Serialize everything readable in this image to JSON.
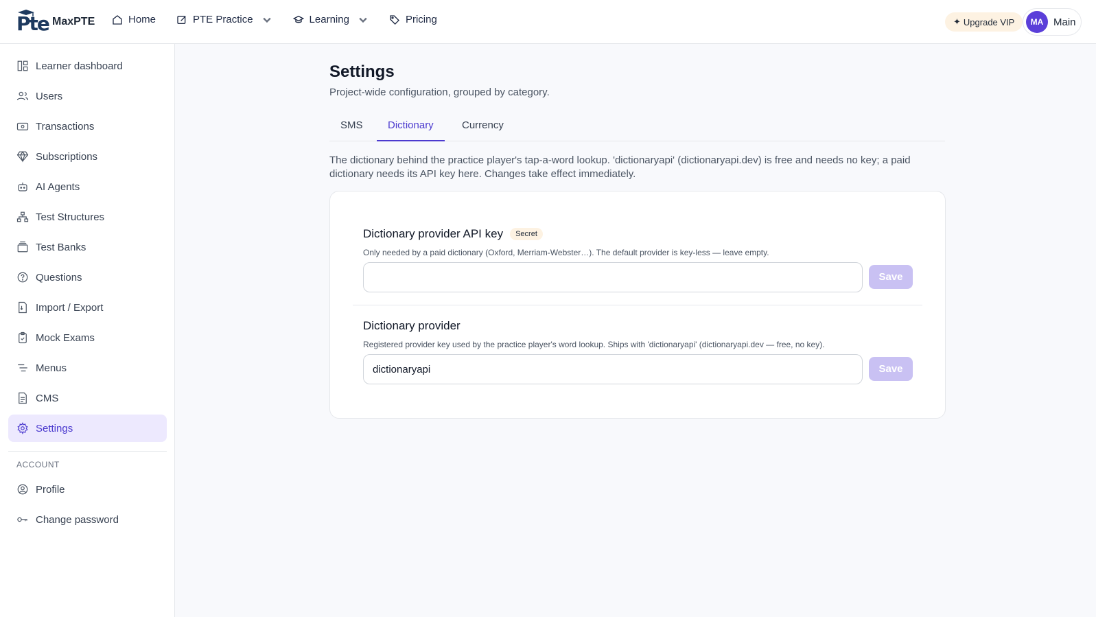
{
  "brand": {
    "name": "MaxPTE",
    "logo_text": "Pte"
  },
  "topnav": {
    "items": [
      {
        "label": "Home",
        "icon": "home-icon"
      },
      {
        "label": "PTE Practice",
        "icon": "edit-icon",
        "dropdown": true
      },
      {
        "label": "Learning",
        "icon": "graduation-cap-icon",
        "dropdown": true
      },
      {
        "label": "Pricing",
        "icon": "tag-icon"
      }
    ],
    "upgrade_label": "Upgrade VIP",
    "user": {
      "initials": "MA",
      "name": "Main"
    }
  },
  "sidebar": {
    "items": [
      {
        "label": "Learner dashboard",
        "icon": "dashboard-icon"
      },
      {
        "label": "Users",
        "icon": "users-icon"
      },
      {
        "label": "Transactions",
        "icon": "money-icon"
      },
      {
        "label": "Subscriptions",
        "icon": "diamond-icon"
      },
      {
        "label": "AI Agents",
        "icon": "robot-icon"
      },
      {
        "label": "Test Structures",
        "icon": "hierarchy-icon"
      },
      {
        "label": "Test Banks",
        "icon": "archive-icon"
      },
      {
        "label": "Questions",
        "icon": "question-icon"
      },
      {
        "label": "Import / Export",
        "icon": "file-transfer-icon"
      },
      {
        "label": "Mock Exams",
        "icon": "clipboard-icon"
      },
      {
        "label": "Menus",
        "icon": "menu-icon"
      },
      {
        "label": "CMS",
        "icon": "document-icon"
      },
      {
        "label": "Settings",
        "icon": "gear-icon",
        "active": true
      }
    ],
    "account_heading": "ACCOUNT",
    "account_items": [
      {
        "label": "Profile",
        "icon": "user-circle-icon"
      },
      {
        "label": "Change password",
        "icon": "key-icon"
      }
    ]
  },
  "page": {
    "title": "Settings",
    "subtitle": "Project-wide configuration, grouped by category.",
    "tabs": [
      {
        "label": "SMS"
      },
      {
        "label": "Dictionary",
        "active": true
      },
      {
        "label": "Currency"
      }
    ],
    "description": "The dictionary behind the practice player's tap-a-word lookup. 'dictionaryapi' (dictionaryapi.dev) is free and needs no key; a paid dictionary needs its API key here. Changes take effect immediately."
  },
  "fields": [
    {
      "label": "Dictionary provider API key",
      "badge": "Secret",
      "help": "Only needed by a paid dictionary (Oxford, Merriam-Webster…). The default provider is key-less — leave empty.",
      "value": "",
      "save_label": "Save"
    },
    {
      "label": "Dictionary provider",
      "help": "Registered provider key used by the practice player's word lookup. Ships with 'dictionaryapi' (dictionaryapi.dev — free, no key).",
      "value": "dictionaryapi",
      "save_label": "Save"
    }
  ],
  "colors": {
    "accent": "#4c3bcf",
    "accent_light": "#ede9fe",
    "button_disabled": "#c9c1f3",
    "badge_bg": "#fdf2e2"
  }
}
